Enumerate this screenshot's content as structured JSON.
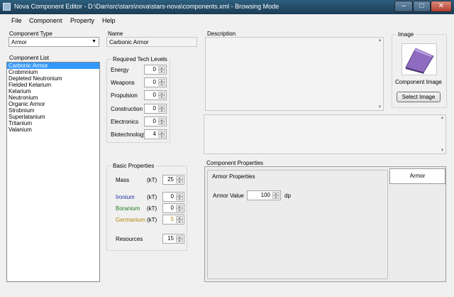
{
  "window": {
    "title": "Nova Component Editor - D:\\Dan\\src\\stars\\nova\\stars-nova\\components.xml - Browsing Mode",
    "minimize": "–",
    "maximize": "□",
    "close": "✕"
  },
  "menu": [
    "File",
    "Component",
    "Property",
    "Help"
  ],
  "component_type": {
    "label": "Component Type",
    "value": "Armor"
  },
  "component_list": {
    "label": "Component List",
    "items": [
      "Carbonic Armor",
      "Crobmnium",
      "Depleted Neutronium",
      "Fielded Kelarium",
      "Kelarium",
      "Neutronium",
      "Organic Armor",
      "Strobnium",
      "Superlatanium",
      "Tritanium",
      "Valanium"
    ],
    "selected": "Carbonic Armor"
  },
  "name": {
    "label": "Name",
    "value": "Carbonic Armor"
  },
  "tech": {
    "title": "Required Tech Levels",
    "levels": [
      {
        "label": "Energy",
        "value": "0"
      },
      {
        "label": "Weapons",
        "value": "0"
      },
      {
        "label": "Propulsion",
        "value": "0"
      },
      {
        "label": "Construction",
        "value": "0"
      },
      {
        "label": "Electronics",
        "value": "0"
      },
      {
        "label": "Biotechnology",
        "value": "4"
      }
    ]
  },
  "description": {
    "label": "Description",
    "value": ""
  },
  "image": {
    "title": "Image",
    "caption": "Component Image",
    "button": "Select Image",
    "icon": "armor-plate-icon"
  },
  "basic": {
    "title": "Basic Properties",
    "mass": {
      "label": "Mass",
      "unit": "(kT)",
      "value": "25"
    },
    "minerals": [
      {
        "label": "Ironium",
        "unit": "(kT)",
        "value": "0",
        "color": "#1f2fa8"
      },
      {
        "label": "Boranium",
        "unit": "(kT)",
        "value": "0",
        "color": "#1b7a1b"
      },
      {
        "label": "Germanium",
        "unit": "(kT)",
        "value": "5",
        "color": "#b8860b"
      }
    ],
    "resources": {
      "label": "Resources",
      "value": "15"
    }
  },
  "component_properties": {
    "title": "Component Properties",
    "group_title": "Armor Properties",
    "armor_value": {
      "label": "Armor Value",
      "value": "100",
      "unit": "dp"
    },
    "tab": "Armor"
  }
}
